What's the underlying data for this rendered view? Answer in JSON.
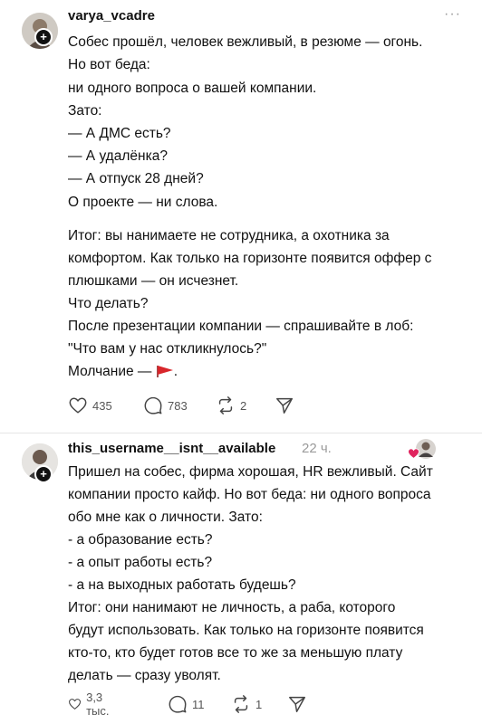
{
  "post1": {
    "username": "varya_vcadre",
    "more_label": "···",
    "lines": [
      "Собес прошёл, человек вежливый, в резюме — огонь.",
      "Но вот беда:",
      "ни одного вопроса о вашей компании.",
      "Зато:",
      "— А ДМС есть?",
      "— А удалёнка?",
      "— А отпуск 28 дней?",
      "О проекте — ни слова.",
      "Итог: вы нанимаете не сотрудника, а охотника за",
      "комфортом. Как только на горизонте появится оффер с",
      "плюшками — он исчезнет.",
      "Что делать?",
      "После презентации компании — спрашивайте в лоб:",
      "\"Что вам у нас откликнулось?\"",
      "Молчание — "
    ],
    "last_line_suffix": ".",
    "flag_icon": "red-flag-icon",
    "likes": "435",
    "comments": "783",
    "reposts": "2"
  },
  "post2": {
    "username": "this_username__isnt__available",
    "time": "22 ч.",
    "lines": [
      "Пришел на собес, фирма хорошая, HR вежливый. Сайт",
      "компании просто кайф. Но вот беда: ни одного вопроса",
      "обо мне как о личности. Зато:",
      "- а образование есть?",
      "- а опыт работы есть?",
      "- а на выходных работать будешь?",
      "Итог: они нанимают не личность, а раба, которого",
      "будут использовать. Как только на горизонте появится",
      "кто-то, кто будет готов все то же за меньшую плату",
      "делать — сразу уволят."
    ],
    "likes": "3,3 тыс.",
    "comments": "11",
    "reposts": "1"
  },
  "colors": {
    "flag": "#d8262b",
    "heart": "#e0245e",
    "muted": "#9a9a9a"
  }
}
